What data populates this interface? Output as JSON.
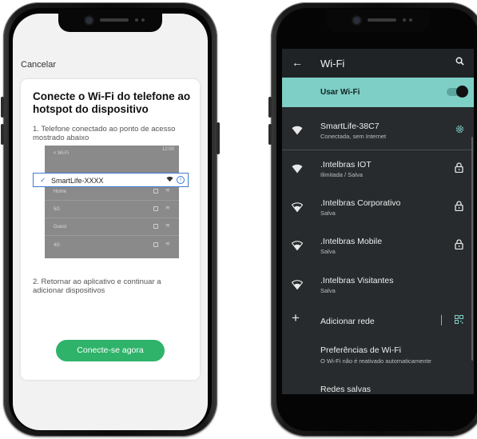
{
  "left_phone": {
    "cancel_label": "Cancelar",
    "card_title": "Conecte o Wi-Fi do telefone ao hotspot do dispositivo",
    "step1": "1. Telefone conectado ao ponto de acesso mostrado abaixo",
    "illustration": {
      "header_label": "< Wi-Fi",
      "status_time": "12:00",
      "selected_ssid": "SmartLife-XXXX",
      "rows": [
        "Home",
        "5G",
        "Guest",
        "4G"
      ]
    },
    "step2": "2. Retornar ao aplicativo e continuar a adicionar dispositivos",
    "cta_label": "Conecte-se agora"
  },
  "right_phone": {
    "title": "Wi-Fi",
    "use_wifi_label": "Usar Wi-Fi",
    "use_wifi_on": true,
    "networks": [
      {
        "name": "SmartLife-38C7",
        "status": "Conectada, sem Internet",
        "icon": "gear-icon"
      },
      {
        "name": ".Intelbras IOT",
        "status": "Ilimitada / Salva",
        "icon": "lock-icon"
      },
      {
        "name": ".Intelbras Corporativo",
        "status": "Salva",
        "icon": "lock-icon"
      },
      {
        "name": ".Intelbras Mobile",
        "status": "Salva",
        "icon": "lock-icon"
      },
      {
        "name": ".Intelbras Visitantes",
        "status": "Salva",
        "icon": ""
      }
    ],
    "add_network_label": "Adicionar rede",
    "preferences_label": "Preferências de Wi-Fi",
    "preferences_sub": "O Wi-Fi não é reativado automaticamente",
    "saved_networks_label": "Redes salvas"
  },
  "colors": {
    "accent_green": "#2fb36a",
    "teal_highlight": "#7ecfc6",
    "dark_bg": "#272b2d",
    "link_blue": "#3d7bd6"
  }
}
